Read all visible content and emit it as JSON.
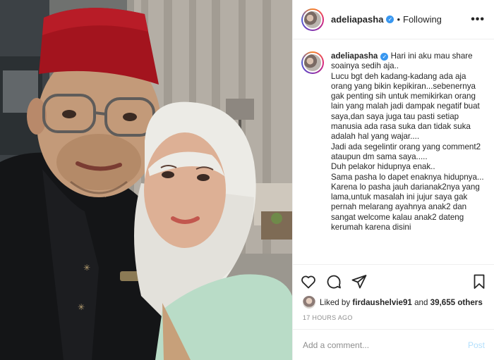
{
  "post": {
    "username": "adeliapasha",
    "verified_icon": "verified-badge-icon",
    "separator": "•",
    "follow_status": "Following",
    "more_label": "•••"
  },
  "caption": {
    "username": "adeliapasha",
    "lines": [
      "Hari ini aku mau share soainya sedih aja..",
      "Lucu bgt deh kadang-kadang ada aja orang yang bikin kepikiran...sebenernya gak penting sih untuk memikirkan orang lain yang malah jadi dampak negatif buat saya,dan saya juga tau pasti setiap manusia ada rasa suka dan tidak suka adalah hal yang wajar....",
      "Jadi ada segelintir orang yang comment2 ataupun dm sama saya.....",
      "Duh pelakor hidupnya enak..",
      "Sama pasha lo dapet enaknya hidupnya...",
      "Karena lo pasha jauh darianak2nya yang lama,untuk masalah ini jujur saya gak pernah melarang ayahnya anak2 dan sangat welcome kalau anak2 dateng kerumah karena disini"
    ]
  },
  "actions": {
    "icons": [
      "heart-icon",
      "comment-icon",
      "share-icon",
      "bookmark-icon"
    ]
  },
  "likes": {
    "prefix": "Liked by",
    "liker": "firdaushelvie91",
    "conjunction": "and",
    "count": "39,655 others"
  },
  "timestamp": "17 HOURS AGO",
  "comment": {
    "placeholder": "Add a comment...",
    "post_label": "Post"
  },
  "colors": {
    "accent": "#3897f0",
    "post_disabled": "#b2dffc",
    "muted": "#8e8e8e"
  }
}
